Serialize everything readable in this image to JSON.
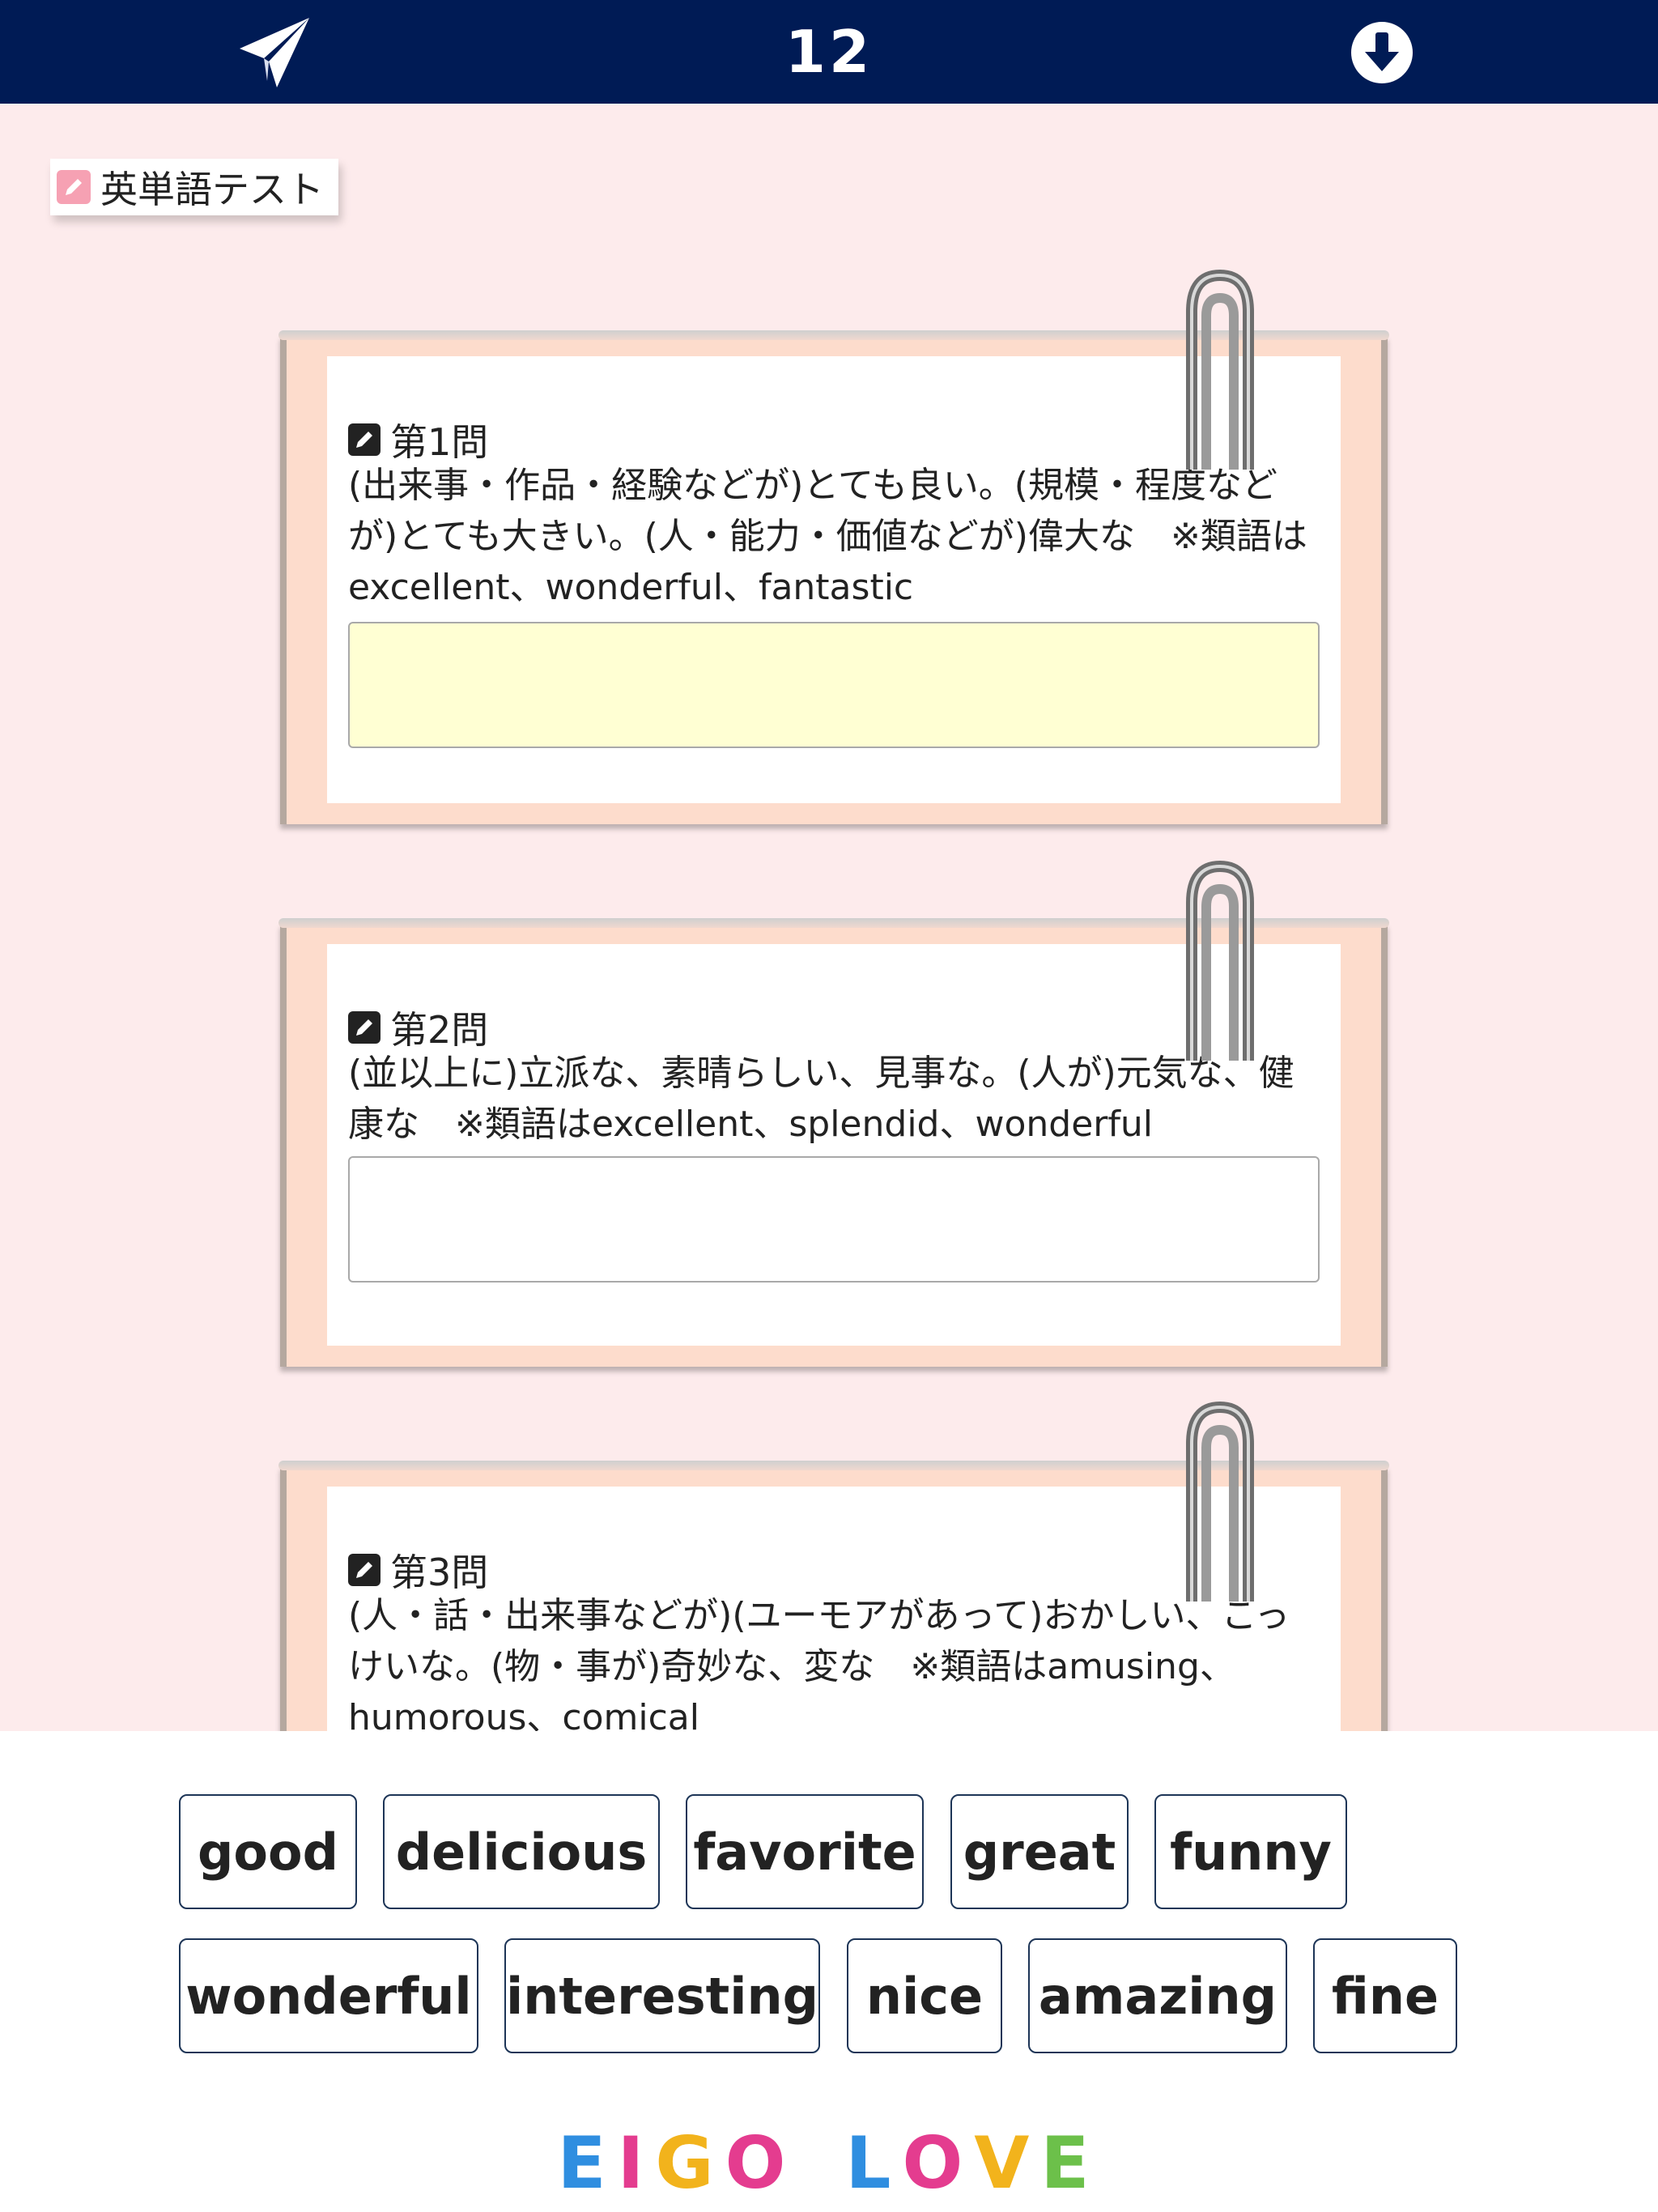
{
  "header": {
    "count": "12",
    "send_icon": "paper-plane-icon",
    "download_icon": "arrow-down-circle-icon",
    "bg_color": "#001b55"
  },
  "label": {
    "text": "英単語テスト",
    "icon": "pencil-icon"
  },
  "questions": [
    {
      "title": "第1問",
      "text": "(出来事・作品・経験などが)とても良い。(規模・程度などが)とても大きい。(人・能力・価値などが)偉大な　※類語はexcellent、wonderful、fantastic",
      "answer": ""
    },
    {
      "title": "第2問",
      "text": "(並以上に)立派な、素晴らしい、見事な。(人が)元気な、健康な　※類語はexcellent、splendid、wonderful",
      "answer": ""
    },
    {
      "title": "第3問",
      "text": "(人・話・出来事などが)(ユーモアがあって)おかしい、こっけいな。(物・事が)奇妙な、変な　※類語はamusing、humorous、comical",
      "answer": ""
    }
  ],
  "word_bank": {
    "row1": [
      "good",
      "delicious",
      "favorite",
      "great",
      "funny"
    ],
    "row2": [
      "wonderful",
      "interesting",
      "nice",
      "amazing",
      "fine"
    ]
  },
  "logo": {
    "letters": [
      "E",
      "I",
      "G",
      "O",
      "L",
      "O",
      "V",
      "E"
    ],
    "colors": [
      "#2f8ee0",
      "#e43c8f",
      "#f2b31c",
      "#e43c8f",
      "#2f8ee0",
      "#e43c8f",
      "#f2b31c",
      "#6cc04a"
    ]
  },
  "colors": {
    "background": "#fdebec",
    "card": "#fddccc",
    "active_field": "#ffffd3"
  }
}
